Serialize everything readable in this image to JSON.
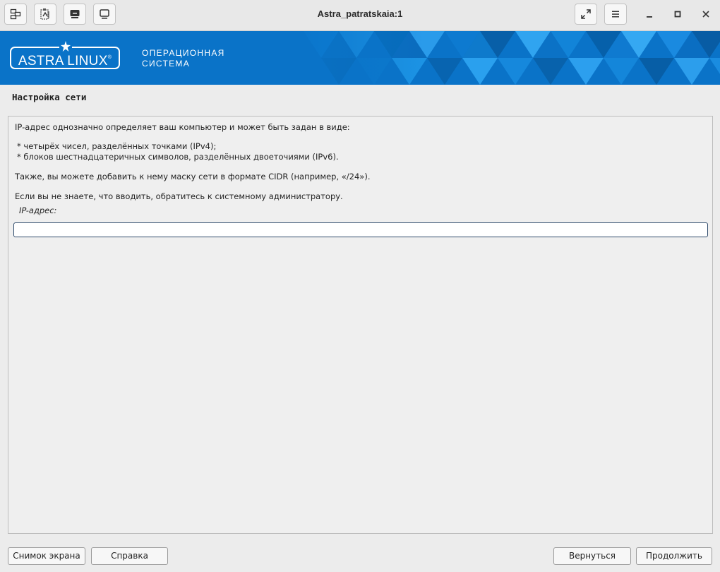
{
  "window": {
    "title": "Astra_patratskaia:1"
  },
  "titlebar": {
    "left_icons": [
      "windows-icon",
      "clipboard-icon",
      "keyboard-icon",
      "monitor-icon"
    ],
    "right_icons": [
      "fullscreen-icon",
      "menu-icon"
    ],
    "window_controls": [
      "minimize-icon",
      "maximize-icon",
      "close-icon"
    ]
  },
  "banner": {
    "logo_text": "ASTRA LINUX",
    "logo_reg": "®",
    "subtitle_line1": "ОПЕРАЦИОННАЯ",
    "subtitle_line2": "СИСТЕМА",
    "color": "#0a73c8"
  },
  "page": {
    "title": "Настройка сети",
    "description": {
      "line1": "IP-адрес однозначно определяет ваш компьютер и может быть задан в виде:",
      "bullet1": "* четырёх чисел, разделённых точками (IPv4);",
      "bullet2": "* блоков шестнадцатеричных символов, разделённых двоеточиями (IPv6).",
      "line2": "Также, вы можете добавить к нему маску сети в формате CIDR (например, «/24»).",
      "line3": "Если вы не знаете, что вводить, обратитесь к системному администратору."
    },
    "ip_field": {
      "label": "IP-адрес:",
      "value": ""
    }
  },
  "buttons": {
    "screenshot": "Снимок экрана",
    "help": "Справка",
    "back": "Вернуться",
    "continue": "Продолжить"
  }
}
